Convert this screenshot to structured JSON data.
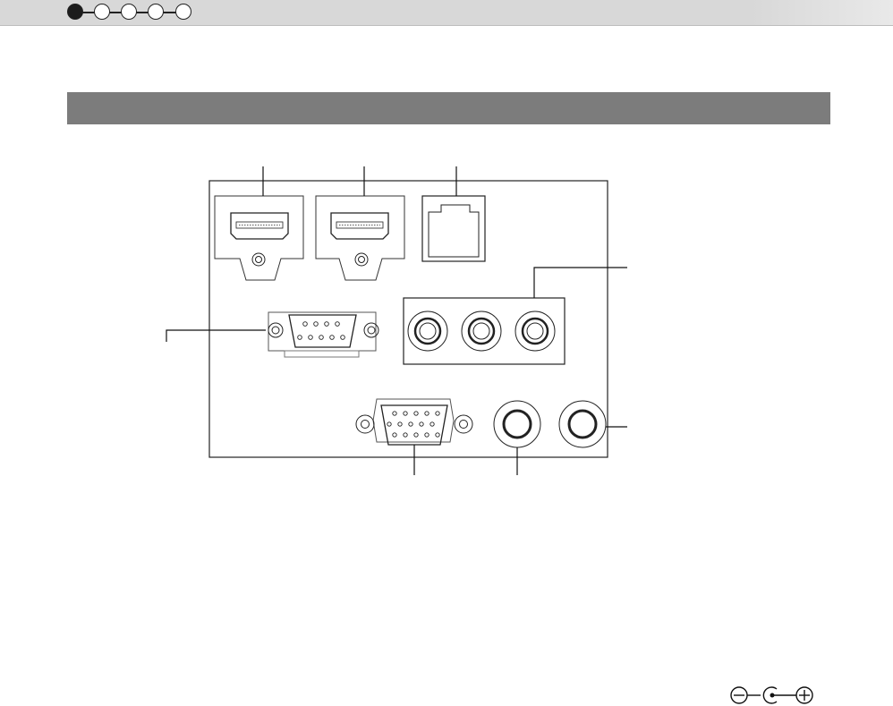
{
  "progress": {
    "steps_total": 5,
    "active_step": 1
  },
  "section": {
    "title": ""
  },
  "panel": {
    "components": [
      "hdmi-port-1-icon",
      "hdmi-port-2-icon",
      "lan-port-icon",
      "serial-port-icon",
      "rca-jacks-icon",
      "vga-port-icon",
      "audio-jack-icon",
      "dc-jack-icon"
    ]
  },
  "polarity": {
    "symbol": "dc-polarity-icon"
  },
  "colors": {
    "top_bar": "#d8d8d8",
    "section_header": "#7c7c7c",
    "line": "#222222"
  }
}
